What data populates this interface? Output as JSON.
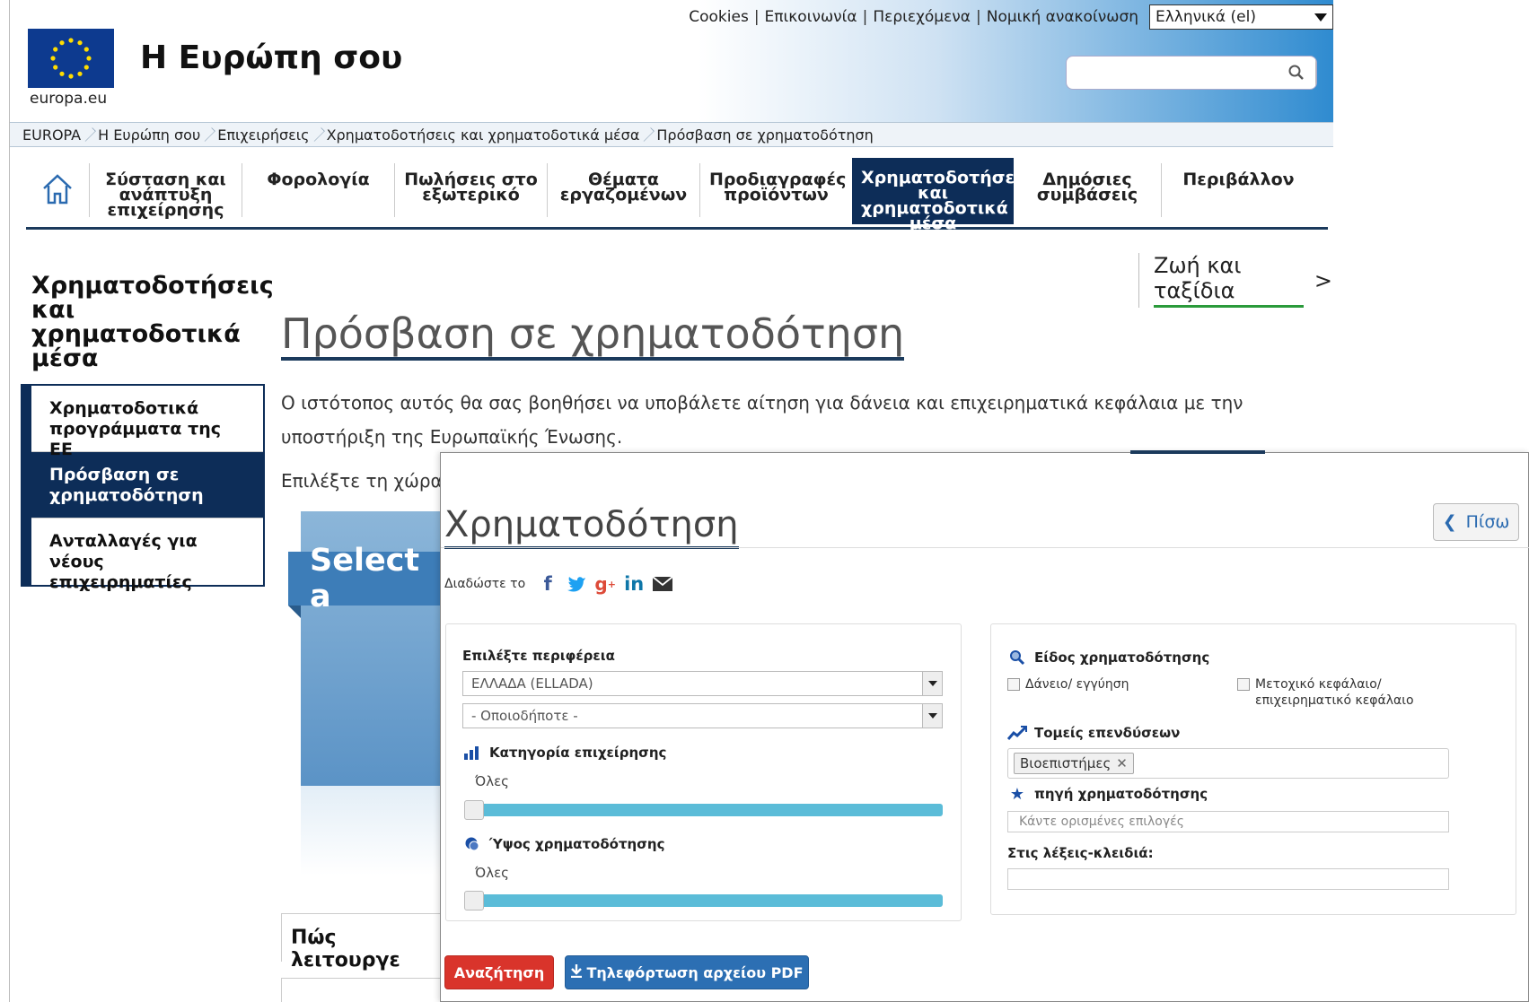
{
  "header": {
    "top_links": [
      "Cookies",
      "Επικοινωνία",
      "Περιεχόμενα",
      "Νομική ανακοίνωση"
    ],
    "language": "Ελληνικά (el)",
    "eu_domain": "europa.eu",
    "site_title": "Η Ευρώπη σου"
  },
  "breadcrumb": [
    "EUROPA",
    "Η Ευρώπη σου",
    "Επιχειρήσεις",
    "Χρηματοδοτήσεις και χρηματοδοτικά μέσα",
    "Πρόσβαση σε χρηματοδότηση"
  ],
  "nav": {
    "items": [
      {
        "label": "Σύσταση και ανάπτυξη επιχείρησης"
      },
      {
        "label": "Φορολογία"
      },
      {
        "label": "Πωλήσεις στο εξωτερικό"
      },
      {
        "label": "Θέματα εργαζομένων"
      },
      {
        "label": "Προδιαγραφές προϊόντων"
      },
      {
        "label": "Χρηματοδοτήσεις και χρηματοδοτικά μέσα"
      },
      {
        "label": "Δημόσιες συμβάσεις"
      },
      {
        "label": "Περιβάλλον"
      }
    ]
  },
  "sidebar": {
    "title": "Χρηματοδοτήσεις και χρηματοδοτικά μέσα",
    "items": [
      {
        "label": "Χρηματοδοτικά προγράμματα της ΕΕ"
      },
      {
        "label": "Πρόσβαση σε χρηματοδότηση"
      },
      {
        "label": "Ανταλλαγές για νέους επιχειρηματίες"
      }
    ]
  },
  "life_link": {
    "label": "Ζωή και ταξίδια",
    "arrow": ">"
  },
  "main": {
    "heading": "Πρόσβαση σε χρηματοδότηση",
    "intro": "Ο ιστότοπος αυτός θα σας βοηθήσει να υποβάλετε αίτηση για δάνεια και επιχειρηματικά κεφάλαια με την υποστήριξη της Ευρωπαϊκής Ένωσης.",
    "choose_country": "Επιλέξτε τη χώρα",
    "select_banner": "Select a",
    "how_it_works": "Πώς λειτουργε"
  },
  "overlay": {
    "title": "Χρηματοδότηση",
    "back_label": "Πίσω",
    "share_label": "Διαδώστε το",
    "left": {
      "region_label": "Επιλέξτε περιφέρεια",
      "region_value": "ΕΛΛΑΔΑ (ELLADA)",
      "subregion_value": "- Οποιοδήποτε -",
      "category_label": "Κατηγορία επιχείρησης",
      "category_value": "Όλες",
      "amount_label": "Ύψος χρηματοδότησης",
      "amount_value": "Όλες"
    },
    "right": {
      "type_label": "Είδος χρηματοδότησης",
      "option_loan": "Δάνειο/ εγγύηση",
      "option_equity": "Μετοχικό κεφάλαιο/ επιχειρηματικό κεφάλαιο",
      "sectors_label": "Τομείς επενδύσεων",
      "sector_tag": "Βιοεπιστήμες",
      "source_label": "πηγή χρηματοδότησης",
      "source_placeholder": "Κάντε ορισμένες επιλογές",
      "keywords_label": "Στις λέξεις-κλειδιά:"
    },
    "search_button": "Αναζήτηση",
    "pdf_button": "Τηλεφόρτωση αρχείου PDF"
  }
}
